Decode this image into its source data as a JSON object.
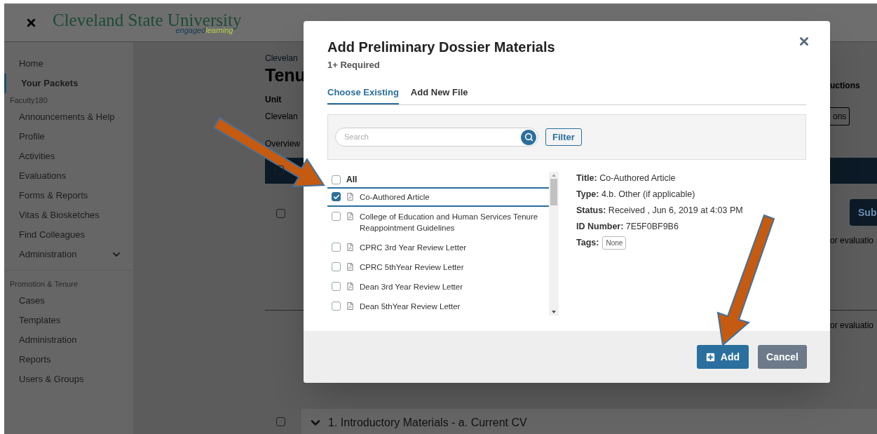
{
  "header": {
    "logo": {
      "name": "Cleveland State University",
      "tagline_first": "engaged",
      "tagline_second": "learning"
    }
  },
  "sidebar": {
    "sections": [
      {
        "items": [
          {
            "label": "Home",
            "selected": false,
            "kind": "link"
          },
          {
            "label": "Your Packets",
            "selected": true,
            "kind": "link"
          }
        ]
      },
      {
        "heading": "Faculty180",
        "items": [
          {
            "label": "Announcements & Help",
            "selected": false,
            "kind": "link"
          },
          {
            "label": "Profile",
            "selected": false,
            "kind": "link"
          },
          {
            "label": "Activities",
            "selected": false,
            "kind": "link"
          },
          {
            "label": "Evaluations",
            "selected": false,
            "kind": "link"
          },
          {
            "label": "Forms & Reports",
            "selected": false,
            "kind": "link"
          },
          {
            "label": "Vitas & Biosketches",
            "selected": false,
            "kind": "link"
          },
          {
            "label": "Find Colleagues",
            "selected": false,
            "kind": "link"
          },
          {
            "label": "Administration",
            "selected": false,
            "kind": "dropdown"
          }
        ]
      },
      {
        "heading": "Promotion & Tenure",
        "items": [
          {
            "label": "Cases",
            "selected": false,
            "kind": "link"
          },
          {
            "label": "Templates",
            "selected": false,
            "kind": "link"
          },
          {
            "label": "Administration",
            "selected": false,
            "kind": "link"
          },
          {
            "label": "Reports",
            "selected": false,
            "kind": "link"
          },
          {
            "label": "Users & Groups",
            "selected": false,
            "kind": "link"
          }
        ]
      }
    ]
  },
  "background": {
    "breadcrumb": "Clevelan",
    "title": "Tenu",
    "unit_label": "Unit",
    "unit_value": "Clevelan",
    "overview": "Overview",
    "instructions_label": "uctions",
    "instructions_button": "ons",
    "submit_button": "Sub",
    "notes": [
      "or evaluatio",
      "or evaluatio"
    ],
    "section_row": "1. Introductory Materials - a. Current CV",
    "header_checkbox": {
      "checked": false
    },
    "row_checkboxes": [
      {
        "checked": false
      },
      {
        "checked": false
      }
    ]
  },
  "dialog": {
    "title": "Add Preliminary Dossier Materials",
    "subtitle": "1+ Required",
    "tabs": [
      {
        "label": "Choose Existing",
        "selected": true
      },
      {
        "label": "Add New File",
        "selected": false
      }
    ],
    "search": {
      "placeholder": "Search"
    },
    "filter_button": "Filter",
    "all": {
      "label": "All",
      "checked": false
    },
    "files": [
      {
        "label": "Co-Authored Article",
        "checked": true,
        "selected": true
      },
      {
        "label": "College of Education and Human Services Tenure Reappointment Guidelines",
        "checked": false,
        "selected": false
      },
      {
        "label": "CPRC 3rd Year Review Letter",
        "checked": false,
        "selected": false
      },
      {
        "label": "CPRC 5thYear Review Letter",
        "checked": false,
        "selected": false
      },
      {
        "label": "Dean 3rd Year Review Letter",
        "checked": false,
        "selected": false
      },
      {
        "label": "Dean 5thYear Review Letter",
        "checked": false,
        "selected": false
      }
    ],
    "details": [
      {
        "label": "Title:",
        "value": "Co-Authored Article"
      },
      {
        "label": "Type:",
        "value": "4.b. Other (if applicable)"
      },
      {
        "label": "Status:",
        "value": "Received , Jun 6, 2019 at 4:03 PM"
      },
      {
        "label": "ID Number:",
        "value": "7E5F0BF9B6"
      }
    ],
    "tags": {
      "label": "Tags:",
      "values": [
        "None"
      ]
    },
    "buttons": [
      {
        "label": "Add",
        "kind": "primary"
      },
      {
        "label": "Cancel",
        "kind": "secondary"
      }
    ]
  }
}
